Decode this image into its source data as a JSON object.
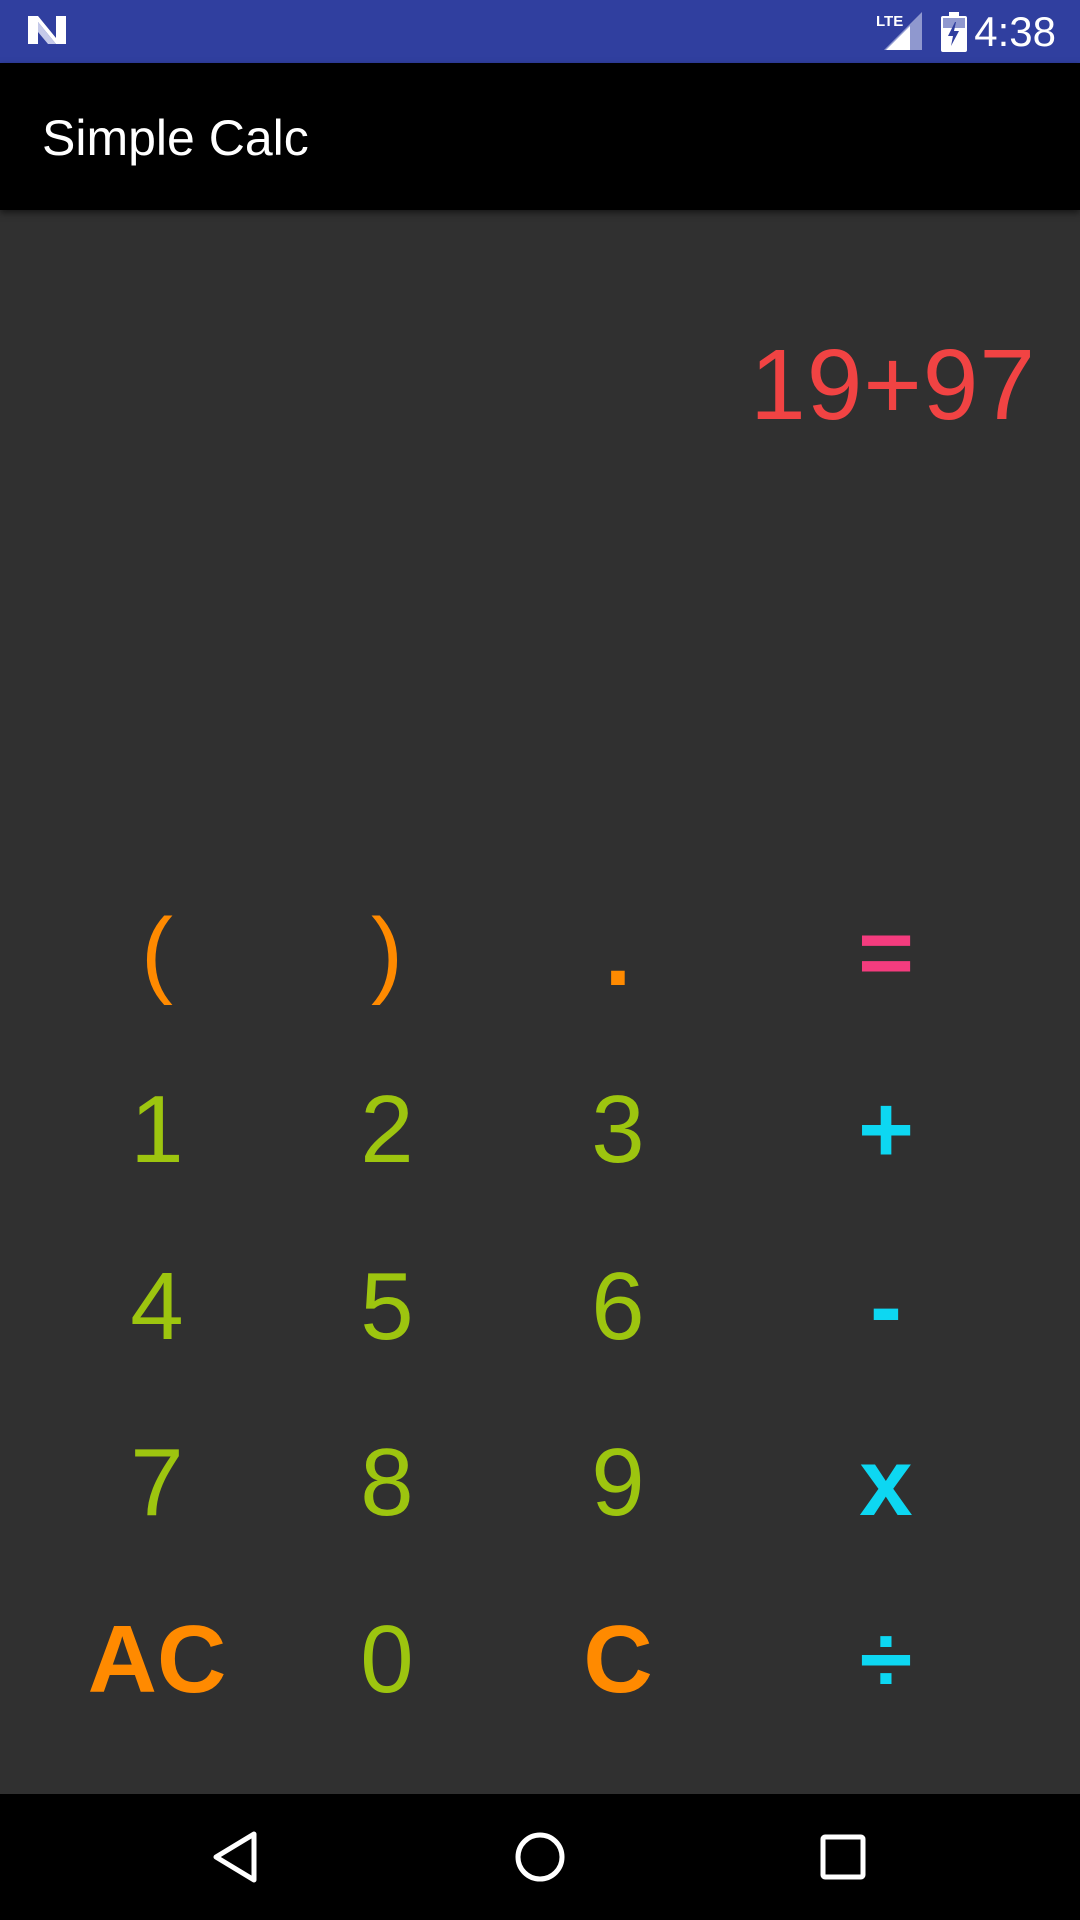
{
  "status_bar": {
    "time": "4:38",
    "network_label": "LTE",
    "icons": [
      "notification-n-icon",
      "lte-signal-icon",
      "battery-charging-icon"
    ]
  },
  "app_bar": {
    "title": "Simple Calc"
  },
  "display": {
    "expression": "19+97"
  },
  "keypad": {
    "row1": [
      "(",
      ")",
      ".",
      "="
    ],
    "row2": [
      "1",
      "2",
      "3",
      "+"
    ],
    "row3": [
      "4",
      "5",
      "6",
      "-"
    ],
    "row4": [
      "7",
      "8",
      "9",
      "x"
    ],
    "row5": [
      "AC",
      "0",
      "C",
      "÷"
    ]
  },
  "colors": {
    "status_bar_bg": "#303F9F",
    "app_bar_bg": "#000000",
    "screen_bg": "#303030",
    "display_text": "#F14343",
    "digit": "#9DC50F",
    "paren_clear": "#FF8A00",
    "operator": "#0DD7F2",
    "equals": "#F43C7E"
  },
  "nav_bar": {
    "icons": [
      "back-icon",
      "home-icon",
      "recents-icon"
    ]
  }
}
